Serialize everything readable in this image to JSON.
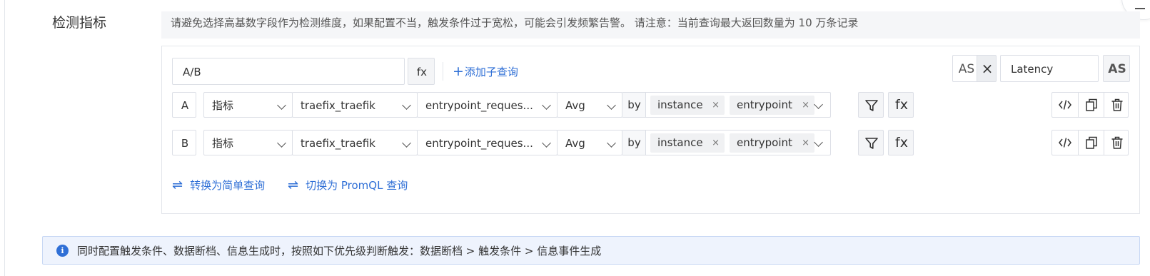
{
  "section": {
    "label": "检测指标"
  },
  "tip": {
    "text": "请避免选择高基数字段作为检测维度，如果配置不当，触发条件过于宽松，可能会引发频繁告警。 请注意：当前查询最大返回数量为 10 万条记录"
  },
  "formula": {
    "value": "A/B",
    "fx_label": "fx",
    "add_subquery_icon": "plus-icon",
    "add_subquery_label": "添加子查询",
    "as_left": "AS",
    "as_close": "×",
    "alias_value": "Latency",
    "as_right": "AS"
  },
  "queries": [
    {
      "letter": "A",
      "type": "指标",
      "source": "traefix_traefik",
      "metric": "entrypoint_reques...",
      "agg": "Avg",
      "by_label": "by",
      "tags": [
        "instance",
        "entrypoint"
      ],
      "tag_remove": "×",
      "fx_label": "fx"
    },
    {
      "letter": "B",
      "type": "指标",
      "source": "traefix_traefik",
      "metric": "entrypoint_reques...",
      "agg": "Avg",
      "by_label": "by",
      "tags": [
        "instance",
        "entrypoint"
      ],
      "tag_remove": "×",
      "fx_label": "fx"
    }
  ],
  "links": {
    "icon": "swap-arrows-icon",
    "to_simple": "转换为简单查询",
    "to_promql": "切换为 PromQL 查询"
  },
  "info": {
    "icon": "info-icon",
    "icon_glyph": "i",
    "text": "同时配置触发条件、数据断档、信息生成时，按照如下优先级判断触发：数据断档 > 触发条件 > 信息事件生成"
  },
  "colors": {
    "accent": "#2f6fd6",
    "info_bg": "#eef3fd",
    "border": "#dcdfe6",
    "tip_bg": "#f5f6f8"
  }
}
